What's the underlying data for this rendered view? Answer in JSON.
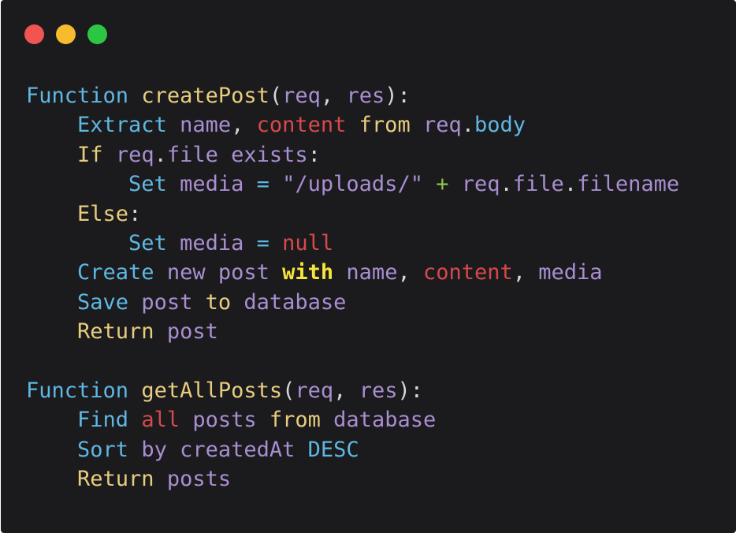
{
  "window": {
    "buttons": [
      {
        "name": "close-button",
        "color": "#f25451"
      },
      {
        "name": "minimize-button",
        "color": "#f9bb2e"
      },
      {
        "name": "maximize-button",
        "color": "#2bc742"
      }
    ]
  },
  "colors": {
    "background": "#1b1b1d",
    "default": "#d8d8d8",
    "keyword": "#5fb7e3",
    "function": "#e8cd7f",
    "variable": "#a98ed2",
    "red": "#d7494c",
    "green": "#8bc54b",
    "highlight": "#f6e33b"
  },
  "code_lines": [
    [
      {
        "t": "Function ",
        "c": "keyword"
      },
      {
        "t": "createPost",
        "c": "function"
      },
      {
        "t": "(",
        "c": "default"
      },
      {
        "t": "req",
        "c": "variable"
      },
      {
        "t": ", ",
        "c": "default"
      },
      {
        "t": "res",
        "c": "variable"
      },
      {
        "t": "):",
        "c": "default"
      }
    ],
    [
      {
        "t": "    ",
        "c": "default"
      },
      {
        "t": "Extract ",
        "c": "keyword"
      },
      {
        "t": "name",
        "c": "variable"
      },
      {
        "t": ", ",
        "c": "default"
      },
      {
        "t": "content ",
        "c": "red"
      },
      {
        "t": "from ",
        "c": "function"
      },
      {
        "t": "req",
        "c": "variable"
      },
      {
        "t": ".",
        "c": "default"
      },
      {
        "t": "body",
        "c": "keyword"
      }
    ],
    [
      {
        "t": "    ",
        "c": "default"
      },
      {
        "t": "If ",
        "c": "function"
      },
      {
        "t": "req",
        "c": "variable"
      },
      {
        "t": ".",
        "c": "default"
      },
      {
        "t": "file exists",
        "c": "variable"
      },
      {
        "t": ":",
        "c": "default"
      }
    ],
    [
      {
        "t": "        ",
        "c": "default"
      },
      {
        "t": "Set ",
        "c": "keyword"
      },
      {
        "t": "media ",
        "c": "variable"
      },
      {
        "t": "= ",
        "c": "keyword"
      },
      {
        "t": "\"/uploads/\" ",
        "c": "variable"
      },
      {
        "t": "+ ",
        "c": "green"
      },
      {
        "t": "req",
        "c": "variable"
      },
      {
        "t": ".",
        "c": "default"
      },
      {
        "t": "file",
        "c": "variable"
      },
      {
        "t": ".",
        "c": "default"
      },
      {
        "t": "filename",
        "c": "variable"
      }
    ],
    [
      {
        "t": "    ",
        "c": "default"
      },
      {
        "t": "Else",
        "c": "function"
      },
      {
        "t": ":",
        "c": "default"
      }
    ],
    [
      {
        "t": "        ",
        "c": "default"
      },
      {
        "t": "Set ",
        "c": "keyword"
      },
      {
        "t": "media ",
        "c": "variable"
      },
      {
        "t": "= ",
        "c": "keyword"
      },
      {
        "t": "null",
        "c": "red"
      }
    ],
    [
      {
        "t": "    ",
        "c": "default"
      },
      {
        "t": "Create ",
        "c": "keyword"
      },
      {
        "t": "new post ",
        "c": "variable"
      },
      {
        "t": "with ",
        "c": "highlight",
        "bold": true
      },
      {
        "t": "name",
        "c": "variable"
      },
      {
        "t": ", ",
        "c": "default"
      },
      {
        "t": "content",
        "c": "red"
      },
      {
        "t": ", ",
        "c": "default"
      },
      {
        "t": "media",
        "c": "variable"
      }
    ],
    [
      {
        "t": "    ",
        "c": "default"
      },
      {
        "t": "Save ",
        "c": "keyword"
      },
      {
        "t": "post ",
        "c": "variable"
      },
      {
        "t": "to ",
        "c": "function"
      },
      {
        "t": "database",
        "c": "variable"
      }
    ],
    [
      {
        "t": "    ",
        "c": "default"
      },
      {
        "t": "Return ",
        "c": "function"
      },
      {
        "t": "post",
        "c": "variable"
      }
    ],
    [],
    [
      {
        "t": "Function ",
        "c": "keyword"
      },
      {
        "t": "getAllPosts",
        "c": "function"
      },
      {
        "t": "(",
        "c": "default"
      },
      {
        "t": "req",
        "c": "variable"
      },
      {
        "t": ", ",
        "c": "default"
      },
      {
        "t": "res",
        "c": "variable"
      },
      {
        "t": "):",
        "c": "default"
      }
    ],
    [
      {
        "t": "    ",
        "c": "default"
      },
      {
        "t": "Find ",
        "c": "keyword"
      },
      {
        "t": "all ",
        "c": "red"
      },
      {
        "t": "posts ",
        "c": "variable"
      },
      {
        "t": "from ",
        "c": "function"
      },
      {
        "t": "database",
        "c": "variable"
      }
    ],
    [
      {
        "t": "    ",
        "c": "default"
      },
      {
        "t": "Sort ",
        "c": "keyword"
      },
      {
        "t": "by createdAt ",
        "c": "variable"
      },
      {
        "t": "DESC",
        "c": "keyword"
      }
    ],
    [
      {
        "t": "    ",
        "c": "default"
      },
      {
        "t": "Return ",
        "c": "function"
      },
      {
        "t": "posts",
        "c": "variable"
      }
    ]
  ]
}
